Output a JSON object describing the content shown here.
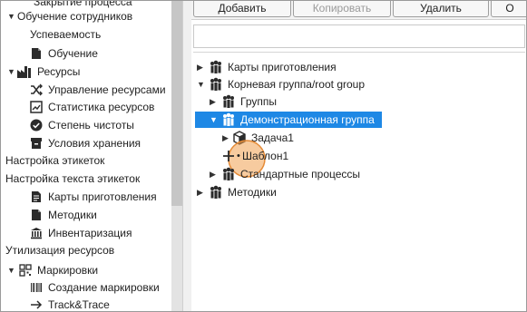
{
  "sidebar": {
    "items": [
      {
        "label": "Закрытие процесса"
      },
      {
        "label": "Обучение сотрудников"
      },
      {
        "label": "Успеваемость"
      },
      {
        "label": "Обучение"
      },
      {
        "label": "Ресурсы"
      },
      {
        "label": "Управление ресурсами"
      },
      {
        "label": "Статистика ресурсов"
      },
      {
        "label": "Степень чистоты"
      },
      {
        "label": "Условия хранения"
      },
      {
        "label": "Настройка этикеток"
      },
      {
        "label": "Настройка текста этикеток"
      },
      {
        "label": "Карты приготовления"
      },
      {
        "label": "Методики"
      },
      {
        "label": "Инвентаризация"
      },
      {
        "label": "Утилизация ресурсов"
      },
      {
        "label": "Маркировки"
      },
      {
        "label": "Создание маркировки"
      },
      {
        "label": "Track&Trace"
      }
    ]
  },
  "toolbar": {
    "add_label": "Добавить",
    "copy_label": "Копировать",
    "delete_label": "Удалить",
    "more_label": "О"
  },
  "tree": {
    "items": [
      {
        "label": "Карты приготовления"
      },
      {
        "label": "Корневая группа/root group"
      },
      {
        "label": "Группы"
      },
      {
        "label": "Демонстрационная группа"
      },
      {
        "label": "Задача1"
      },
      {
        "label": "Шаблон1"
      },
      {
        "label": "Стандартные процессы"
      },
      {
        "label": "Методики"
      }
    ]
  },
  "colors": {
    "selection": "#1e88e5",
    "cursor_highlight": "#f0a050"
  }
}
